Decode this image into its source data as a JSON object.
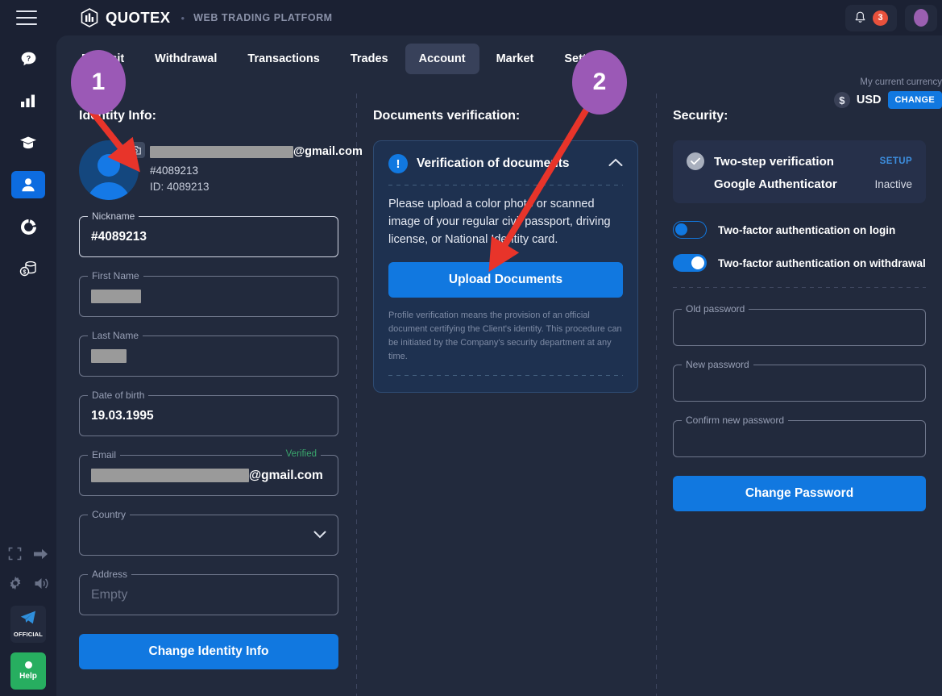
{
  "header": {
    "brand": "QUOTEX",
    "separator": "•",
    "subtitle": "WEB TRADING PLATFORM",
    "notification_count": "3"
  },
  "currency": {
    "label": "My current currency",
    "symbol": "$",
    "code": "USD",
    "change_button": "CHANGE"
  },
  "tabs": [
    {
      "label": "Deposit",
      "active": false
    },
    {
      "label": "Withdrawal",
      "active": false
    },
    {
      "label": "Transactions",
      "active": false
    },
    {
      "label": "Trades",
      "active": false
    },
    {
      "label": "Account",
      "active": true
    },
    {
      "label": "Market",
      "active": false
    },
    {
      "label": "Settings",
      "active": false
    }
  ],
  "rail": {
    "items": [
      {
        "name": "help-icon",
        "active": false
      },
      {
        "name": "chart-icon",
        "active": false
      },
      {
        "name": "education-icon",
        "active": false
      },
      {
        "name": "account-icon",
        "active": true
      },
      {
        "name": "analytics-icon",
        "active": false
      },
      {
        "name": "finance-icon",
        "active": false
      }
    ],
    "telegram_label": "OFFICIAL",
    "help_label": "Help"
  },
  "identity": {
    "title": "Identity Info:",
    "email_suffix": "@gmail.com",
    "nickname_tag": "#4089213",
    "id_line": "ID: 4089213",
    "fields": [
      {
        "label": "Nickname",
        "value": "#4089213",
        "placeholder": "",
        "type": "text",
        "strong": true
      },
      {
        "label": "First Name",
        "value": "",
        "placeholder": "",
        "type": "redacted",
        "strong": false
      },
      {
        "label": "Last Name",
        "value": "",
        "placeholder": "",
        "type": "redacted",
        "strong": false
      },
      {
        "label": "Date of birth",
        "value": "19.03.1995",
        "placeholder": "",
        "type": "text",
        "strong": false
      },
      {
        "label": "Email",
        "value": "@gmail.com",
        "placeholder": "",
        "type": "email",
        "badge": "Verified",
        "strong": false
      },
      {
        "label": "Country",
        "value": "",
        "placeholder": "",
        "type": "select",
        "strong": false
      },
      {
        "label": "Address",
        "value": "",
        "placeholder": "Empty",
        "type": "text",
        "strong": false
      }
    ],
    "submit_label": "Change Identity Info"
  },
  "documents": {
    "title": "Documents verification:",
    "card_title": "Verification of documents",
    "info_glyph": "!",
    "description": "Please upload a color photo or scanned image of your regular civil passport, driving license, or National Identity card.",
    "upload_button": "Upload Documents",
    "note": "Profile verification means the provision of an official document certifying the Client's identity. This procedure can be initiated by the Company's security department at any time."
  },
  "security": {
    "title": "Security:",
    "two_step_label": "Two-step verification",
    "setup_label": "SETUP",
    "authenticator_label": "Google Authenticator",
    "authenticator_status": "Inactive",
    "toggles": [
      {
        "label": "Two-factor authentication on login",
        "on": false
      },
      {
        "label": "Two-factor authentication on withdrawal",
        "on": true
      }
    ],
    "password_fields": [
      {
        "label": "Old password",
        "value": ""
      },
      {
        "label": "New password",
        "value": ""
      },
      {
        "label": "Confirm new password",
        "value": ""
      }
    ],
    "submit_label": "Change Password"
  },
  "annotations": [
    {
      "number": "1"
    },
    {
      "number": "2"
    }
  ],
  "colors": {
    "accent_blue": "#1178e0",
    "bg_dark": "#1b2133",
    "panel": "#222a3d",
    "annotation_purple": "#9b59b6",
    "arrow_red": "#e8342a",
    "verified_green": "#3aa76d",
    "help_green": "#27ae60",
    "badge_red": "#e8513c"
  }
}
